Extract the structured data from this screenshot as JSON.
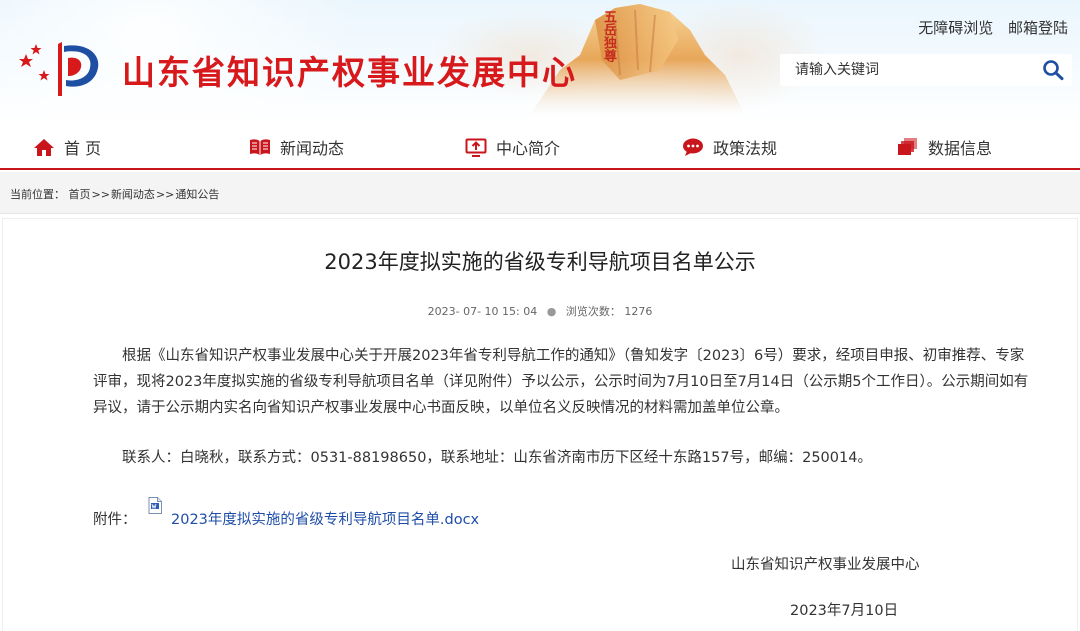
{
  "header": {
    "site_title": "山东省知识产权事业发展中心",
    "top_links": [
      "无障碍浏览",
      "邮箱登陆"
    ],
    "search": {
      "placeholder": "请输入关键词",
      "value": ""
    },
    "mountain_text": "五岳独尊",
    "colors": {
      "brand_red": "#d7191c",
      "nav_red": "#c9161d"
    }
  },
  "nav": {
    "items": [
      {
        "label": "首 页",
        "icon": "home-icon"
      },
      {
        "label": "新闻动态",
        "icon": "book-icon"
      },
      {
        "label": "中心简介",
        "icon": "screen-arrow-icon"
      },
      {
        "label": "政策法规",
        "icon": "chat-bubble-icon"
      },
      {
        "label": "数据信息",
        "icon": "stack-icon"
      }
    ]
  },
  "breadcrumb": {
    "prefix": "当前位置：",
    "items": [
      "首页",
      "新闻动态",
      "通知公告"
    ],
    "separator": ">>"
  },
  "article": {
    "title": "2023年度拟实施的省级专利导航项目名单公示",
    "date": "2023- 07- 10 15: 04",
    "views_label": "浏览次数：",
    "views": "1276",
    "paragraph1": "根据《山东省知识产权事业发展中心关于开展2023年省专利导航工作的通知》（鲁知发字〔2023〕6号）要求，经项目申报、初审推荐、专家评审，现将2023年度拟实施的省级专利导航项目名单（详见附件）予以公示，公示时间为7月10日至7月14日（公示期5个工作日）。公示期间如有异议，请于公示期内实名向省知识产权事业发展中心书面反映，以单位名义反映情况的材料需加盖单位公章。",
    "paragraph2": "联系人：白晓秋，联系方式：0531-88198650，联系地址：山东省济南市历下区经十东路157号，邮编：250014。",
    "attachment_label": "附件：",
    "attachment_file": "2023年度拟实施的省级专利导航项目名单.docx",
    "sign_org": "山东省知识产权事业发展中心",
    "sign_date": "2023年7月10日"
  }
}
